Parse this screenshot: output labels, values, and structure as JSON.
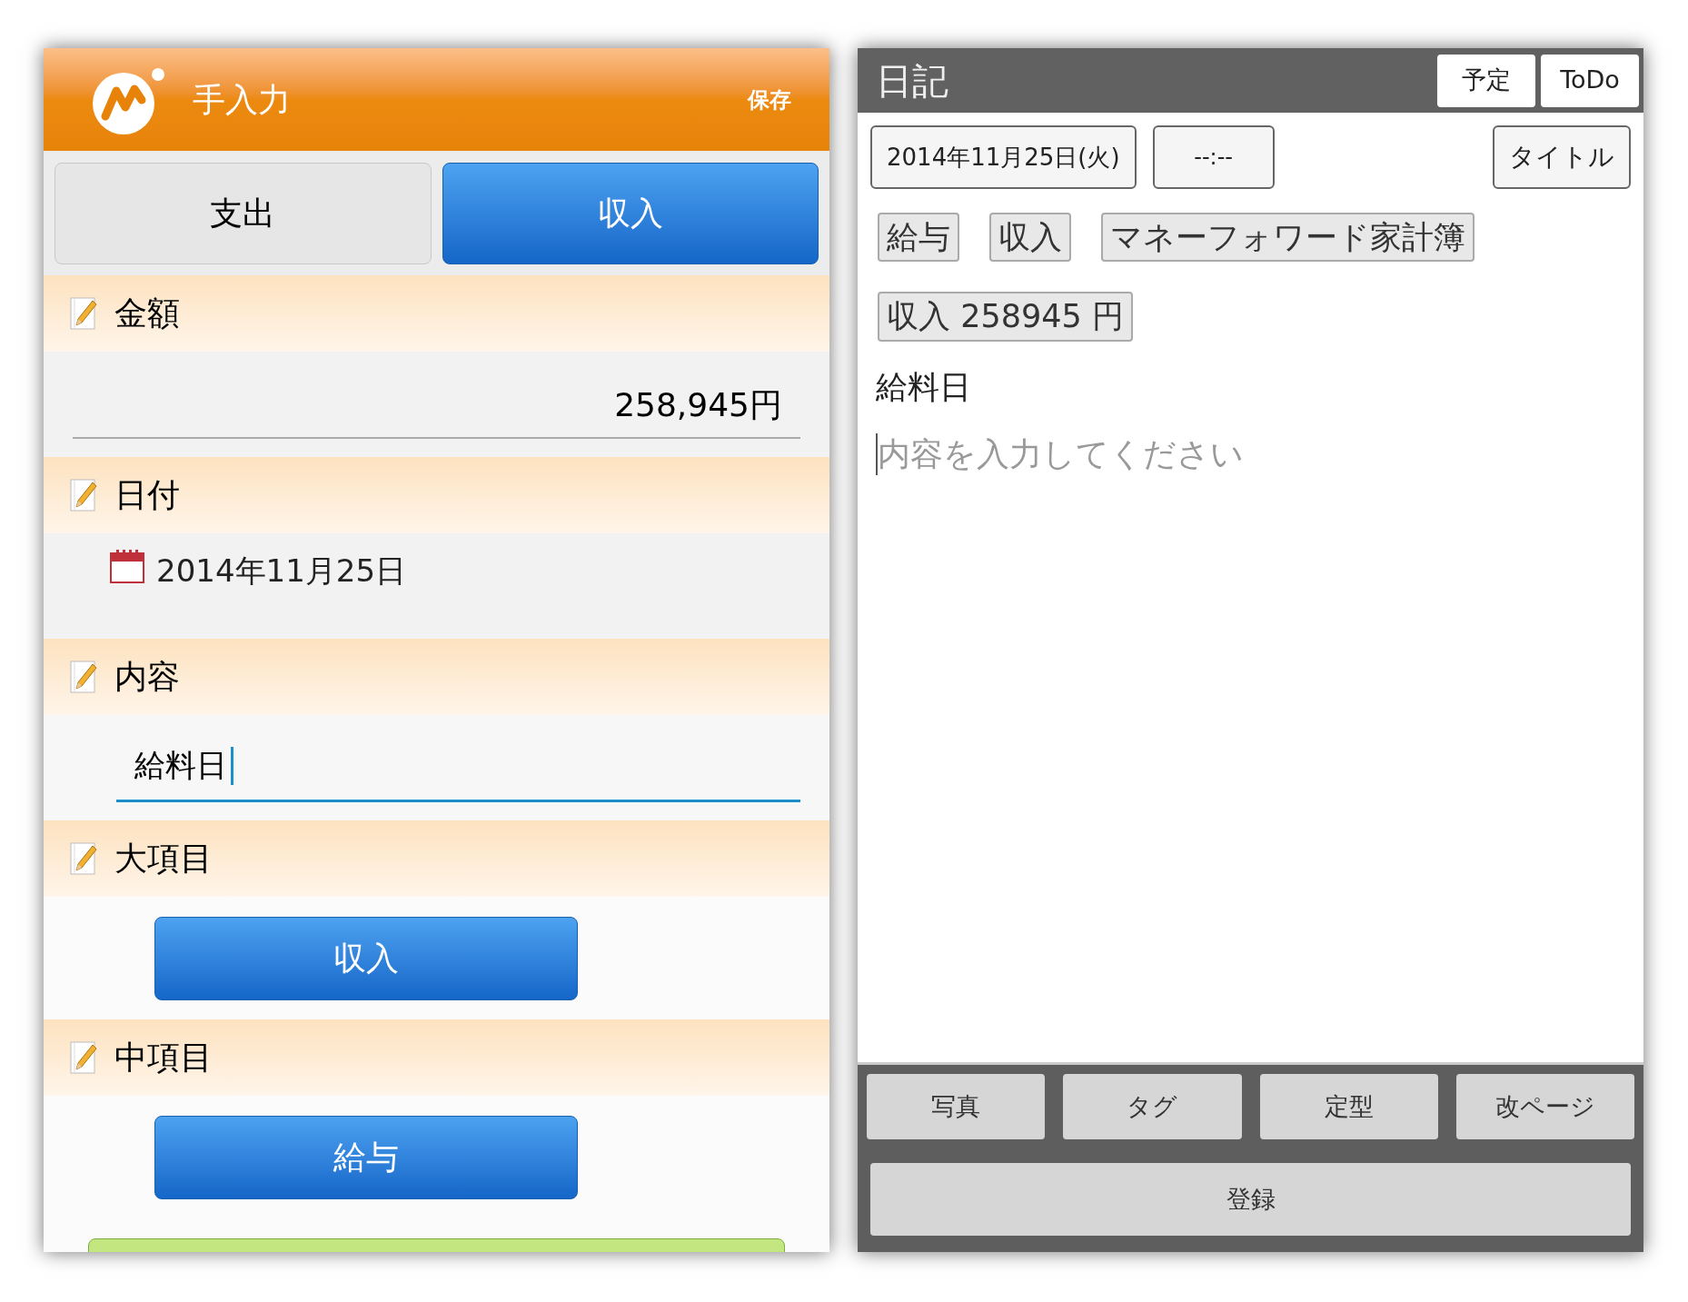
{
  "input_screen": {
    "title": "手入力",
    "save": "保存",
    "tabs": [
      {
        "label": "支出",
        "selected": false
      },
      {
        "label": "収入",
        "selected": true
      }
    ],
    "sections": [
      {
        "kind": "amount",
        "label": "金額",
        "value": "258,945円"
      },
      {
        "kind": "date",
        "label": "日付",
        "value": "2014年11月25日"
      },
      {
        "kind": "text",
        "label": "内容",
        "value": "給料日",
        "focused": true
      },
      {
        "kind": "category",
        "label": "大項目",
        "value": "収入"
      },
      {
        "kind": "category",
        "label": "中項目",
        "value": "給与"
      }
    ]
  },
  "diary_screen": {
    "title": "日記",
    "header_buttons": [
      "予定",
      "ToDo"
    ],
    "date_button": "2014年11月25日(火)",
    "time_button": "--:--",
    "title_button": "タイトル",
    "tags": [
      "給与",
      "収入",
      "マネーフォワード家計簿"
    ],
    "amount_tag": "収入 258945 円",
    "entry_title": "給料日",
    "body": {
      "placeholder": "内容を入力してください"
    },
    "toolbar": [
      "写真",
      "タグ",
      "定型",
      "改ページ"
    ],
    "register": "登録"
  }
}
